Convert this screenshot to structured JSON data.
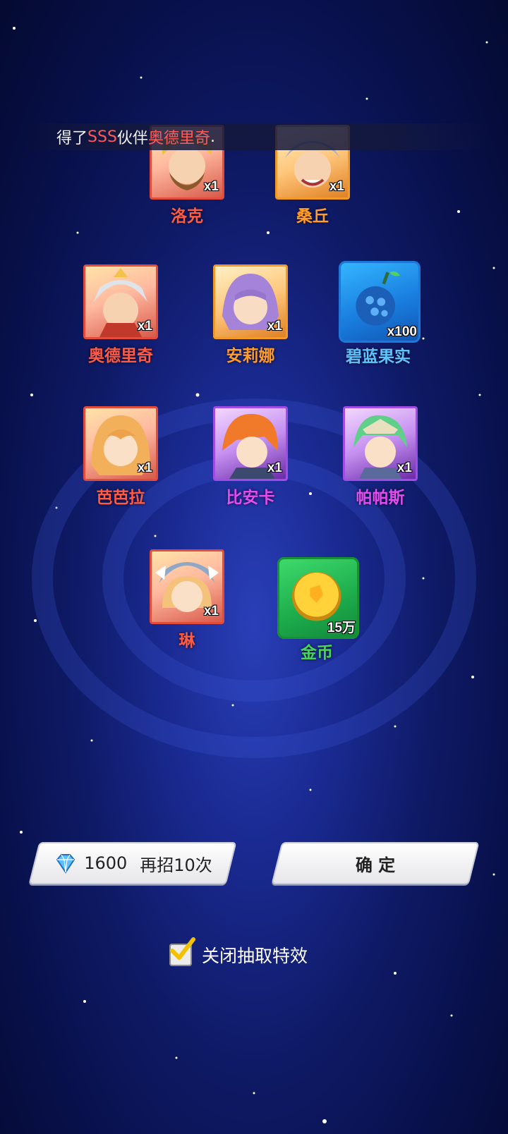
{
  "banner": {
    "prefix": "得了",
    "rarity": "SSS",
    "middle": "伙伴",
    "hero": "奥德里奇",
    "suffix": "."
  },
  "rewards": [
    {
      "name": "洛克",
      "qty": "x1",
      "frame": "red",
      "name_color": "red"
    },
    {
      "name": "桑丘",
      "qty": "x1",
      "frame": "orange",
      "name_color": "orange"
    },
    {
      "name": "奥德里奇",
      "qty": "x1",
      "frame": "red",
      "name_color": "red"
    },
    {
      "name": "安莉娜",
      "qty": "x1",
      "frame": "orange",
      "name_color": "orange"
    },
    {
      "name": "碧蓝果实",
      "qty": "x100",
      "frame": "blue-item",
      "name_color": "blue",
      "icon": "blue-fruit-icon"
    },
    {
      "name": "芭芭拉",
      "qty": "x1",
      "frame": "red",
      "name_color": "red"
    },
    {
      "name": "比安卡",
      "qty": "x1",
      "frame": "purple",
      "name_color": "purple"
    },
    {
      "name": "帕帕斯",
      "qty": "x1",
      "frame": "purple",
      "name_color": "purple"
    },
    {
      "name": "琳",
      "qty": "x1",
      "frame": "red",
      "name_color": "red"
    },
    {
      "name": "金币",
      "qty": "15万",
      "frame": "green-item",
      "name_color": "green",
      "icon": "gold-coin-icon"
    }
  ],
  "buttons": {
    "recruit_cost": "1600",
    "recruit_label": "再招10次",
    "confirm_label": "确 定"
  },
  "toggle": {
    "label": "关闭抽取特效",
    "checked": true
  }
}
